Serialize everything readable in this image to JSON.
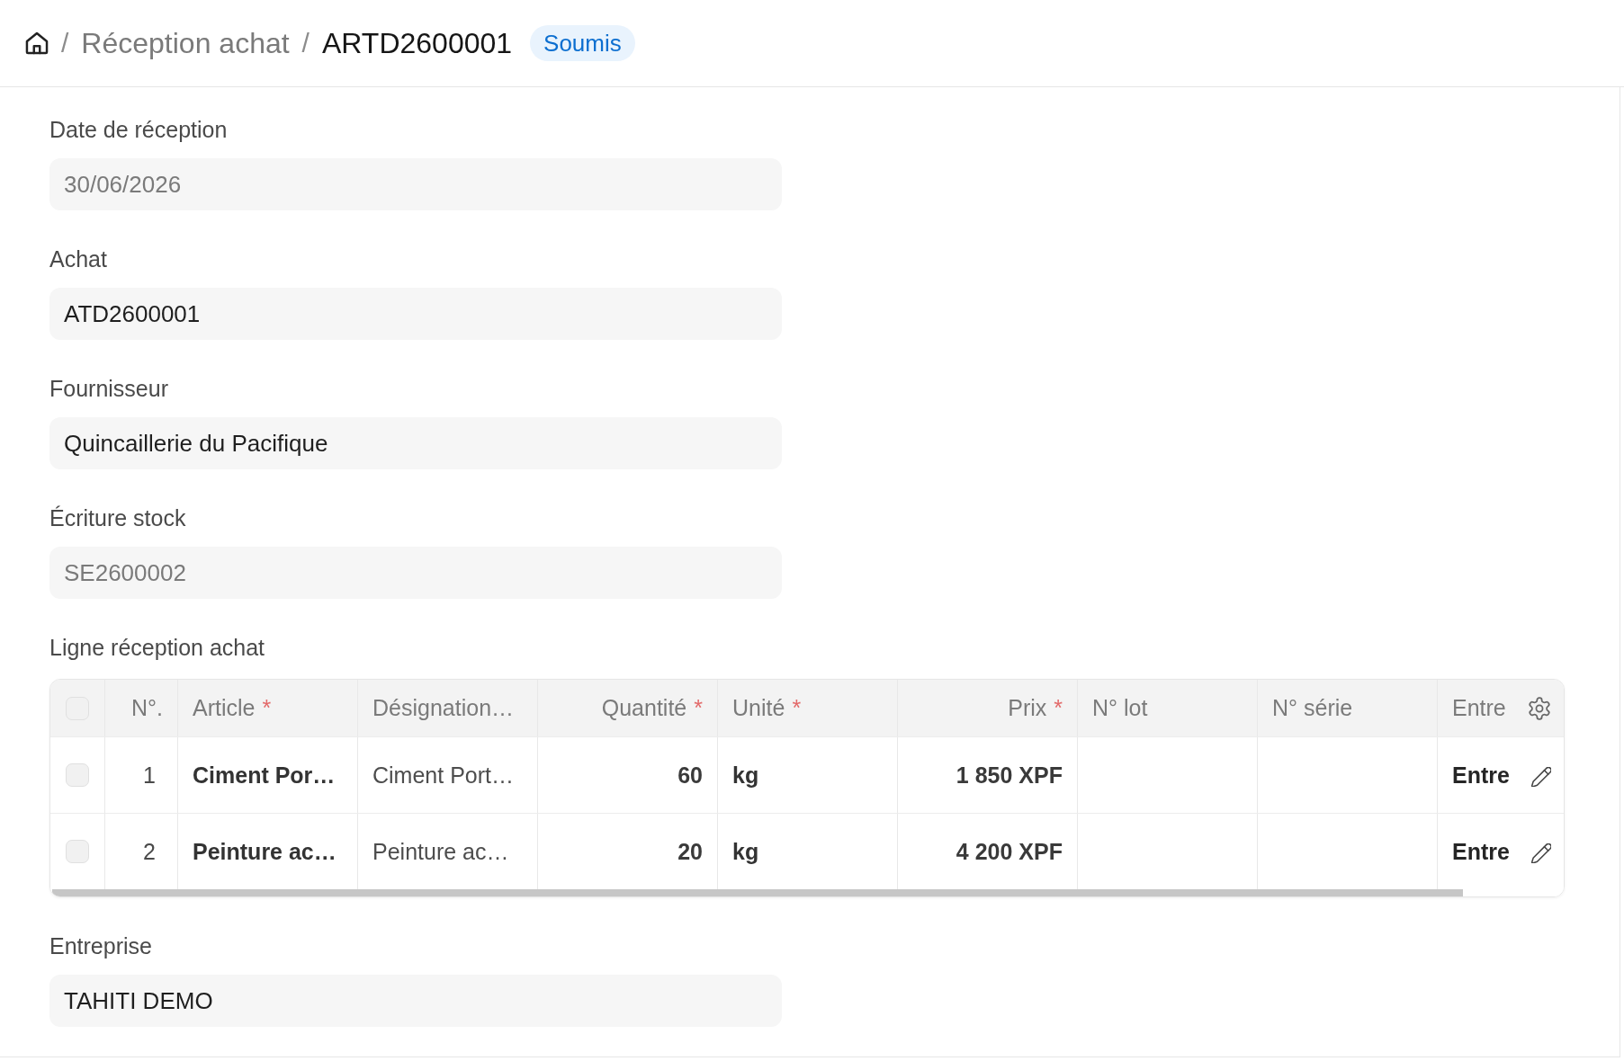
{
  "breadcrumb": {
    "items": [
      {
        "kind": "home"
      },
      {
        "kind": "link",
        "label": "Réception achat"
      },
      {
        "kind": "current",
        "label": "ARTD2600001"
      }
    ],
    "separators": [
      "/",
      "/"
    ],
    "status": "Soumis"
  },
  "form": [
    {
      "kind": "field",
      "label": "Date de réception",
      "value": "30/06/2026",
      "disabled": true
    },
    {
      "kind": "field",
      "label": "Achat",
      "value": "ATD2600001",
      "disabled": false
    },
    {
      "kind": "field",
      "label": "Fournisseur",
      "value": "Quincaillerie du Pacifique",
      "disabled": false
    },
    {
      "kind": "field",
      "label": "Écriture stock",
      "value": "SE2600002",
      "disabled": true
    },
    {
      "kind": "table",
      "label": "Ligne réception achat",
      "select_all": {
        "checked": false
      },
      "columns": [
        {
          "label": "N°.",
          "kind": "index"
        },
        {
          "label": "Article",
          "required_mark": "*",
          "kind": "link"
        },
        {
          "label": "Désignation…",
          "kind": "text"
        },
        {
          "label": "Quantité",
          "required_mark": "*",
          "kind": "number"
        },
        {
          "label": "Unité",
          "required_mark": "*",
          "kind": "link"
        },
        {
          "label": "Prix",
          "required_mark": "*",
          "kind": "number"
        },
        {
          "label": "N° lot",
          "kind": "text"
        },
        {
          "label": "N° série",
          "kind": "text"
        },
        {
          "label": "Entre",
          "kind": "link"
        }
      ],
      "rows": [
        {
          "checked": false,
          "cells": [
            "1",
            "Ciment Por…",
            "Ciment Port…",
            "60",
            "kg",
            "1 850 XPF",
            null,
            null,
            "Entre"
          ]
        },
        {
          "checked": false,
          "cells": [
            "2",
            "Peinture ac…",
            "Peinture ac…",
            "20",
            "kg",
            "4 200 XPF",
            null,
            null,
            "Entre"
          ]
        }
      ]
    },
    {
      "kind": "field",
      "label": "Entreprise",
      "value": "TAHITI DEMO",
      "disabled": false
    }
  ]
}
